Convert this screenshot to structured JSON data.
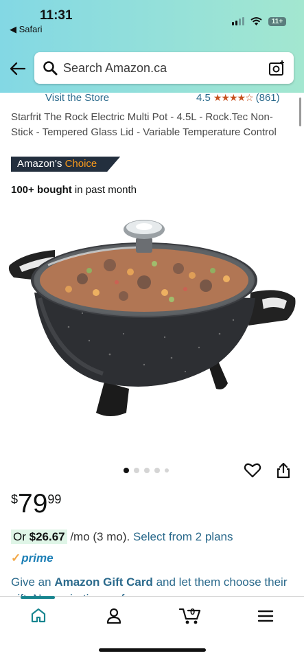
{
  "status": {
    "time": "11:31",
    "back_app": "◀ Safari",
    "battery": "11+"
  },
  "search": {
    "placeholder": "Search Amazon.ca"
  },
  "store": {
    "link": "Visit the Store",
    "rating": "4.5",
    "stars": "★★★★☆",
    "reviews": "(861)"
  },
  "product": {
    "title": "Starfrit The Rock Electric Multi Pot - 4.5L - Rock.Tec Non-Stick - Tempered Glass Lid - Variable Temperature Control",
    "badge_prefix": "Amazon's",
    "badge_suffix": "Choice",
    "bought_bold": "100+ bought",
    "bought_rest": " in past month"
  },
  "carousel": {
    "dots": 5,
    "active": 0
  },
  "price": {
    "currency": "$",
    "whole": "79",
    "fraction": "99"
  },
  "financing": {
    "prefix": "Or ",
    "amount": "$26.67",
    "term": " /mo (3 mo). ",
    "plans": "Select from 2 plans"
  },
  "prime": {
    "check": "✓",
    "label": "prime"
  },
  "gift": {
    "prefix": "Give an ",
    "bold": "Amazon Gift Card",
    "suffix": " and let them choose their gift. No expiration on fees."
  },
  "nav": {
    "items": [
      "home",
      "account",
      "cart",
      "menu"
    ],
    "cart_count": "0"
  },
  "colors": {
    "accent": "#17858f",
    "link": "#2b6a8c",
    "badge_bg": "#232f3e",
    "badge_orange": "#f99a1c",
    "header_gradient": [
      "#83d8e4",
      "#a3e7d0"
    ]
  }
}
